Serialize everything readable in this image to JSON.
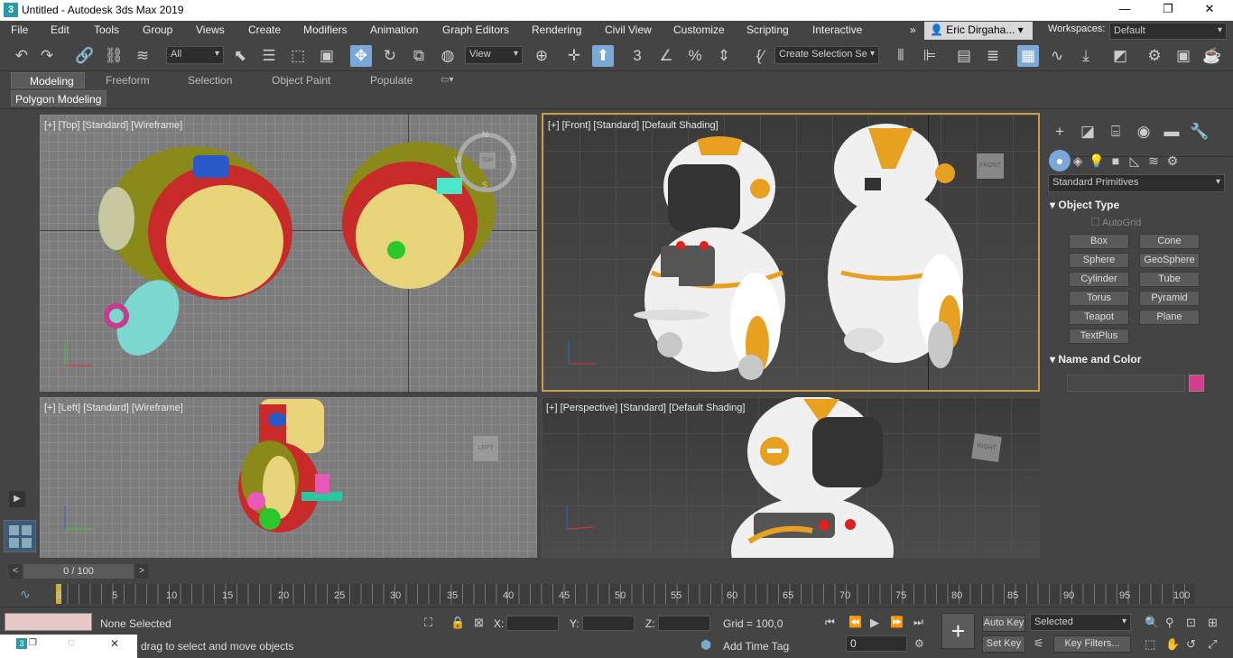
{
  "window": {
    "title": "Untitled - Autodesk 3ds Max 2019",
    "app_icon": "3",
    "minimize": "—",
    "maximize": "❐",
    "close": "✕"
  },
  "menu": [
    "File",
    "Edit",
    "Tools",
    "Group",
    "Views",
    "Create",
    "Modifiers",
    "Animation",
    "Graph Editors",
    "Rendering",
    "Civil View",
    "Customize",
    "Scripting",
    "Interactive"
  ],
  "menu_overflow": "»",
  "user": {
    "name": "Eric Dirgaha...",
    "workspace_label": "Workspaces:",
    "workspace_value": "Default"
  },
  "toolbar": {
    "selection_filter": "All",
    "ref_coord": "View",
    "named_selection": "Create Selection Se"
  },
  "ribbon": {
    "tabs": [
      "Modeling",
      "Freeform",
      "Selection",
      "Object Paint",
      "Populate"
    ],
    "active_tab": "Modeling",
    "subtab": "Polygon Modeling"
  },
  "viewports": {
    "top": "[+] [Top] [Standard] [Wireframe]",
    "front": "[+] [Front] [Standard] [Default Shading]",
    "left": "[+] [Left] [Standard] [Wireframe]",
    "perspective": "[+] [Perspective] [Standard] [Default Shading]",
    "viewcube_front": "FRONT",
    "viewcube_left": "LEFT",
    "viewcube_right": "RIGHT",
    "viewcube_top": "TOP",
    "compass": {
      "n": "N",
      "s": "S",
      "e": "E",
      "w": "W"
    }
  },
  "command_panel": {
    "category": "Standard Primitives",
    "object_type_title": "Object Type",
    "autogrid": "AutoGrid",
    "buttons": [
      "Box",
      "Cone",
      "Sphere",
      "GeoSphere",
      "Cylinder",
      "Tube",
      "Torus",
      "Pyramid",
      "Teapot",
      "Plane",
      "TextPlus"
    ],
    "name_color_title": "Name and Color",
    "object_color": "#d63c8c"
  },
  "timeline": {
    "frame_display": "0 / 100",
    "ticks": [
      "0",
      "5",
      "10",
      "15",
      "20",
      "25",
      "30",
      "35",
      "40",
      "45",
      "50",
      "55",
      "60",
      "65",
      "70",
      "75",
      "80",
      "85",
      "90",
      "95",
      "100"
    ]
  },
  "status": {
    "selection": "None Selected",
    "prompt": "drag to select and move objects",
    "x_label": "X:",
    "y_label": "Y:",
    "z_label": "Z:",
    "grid": "Grid = 100,0",
    "add_time_tag": "Add Time Tag",
    "auto_key": "Auto Key",
    "set_key": "Set Key",
    "key_mode": "Selected",
    "key_filters": "Key Filters...",
    "current_frame": "0"
  },
  "colors": {
    "accent": "#7aa8d8",
    "background": "#444444",
    "viewport_wire": "#7c7c7c",
    "active_border": "#c8a040"
  }
}
